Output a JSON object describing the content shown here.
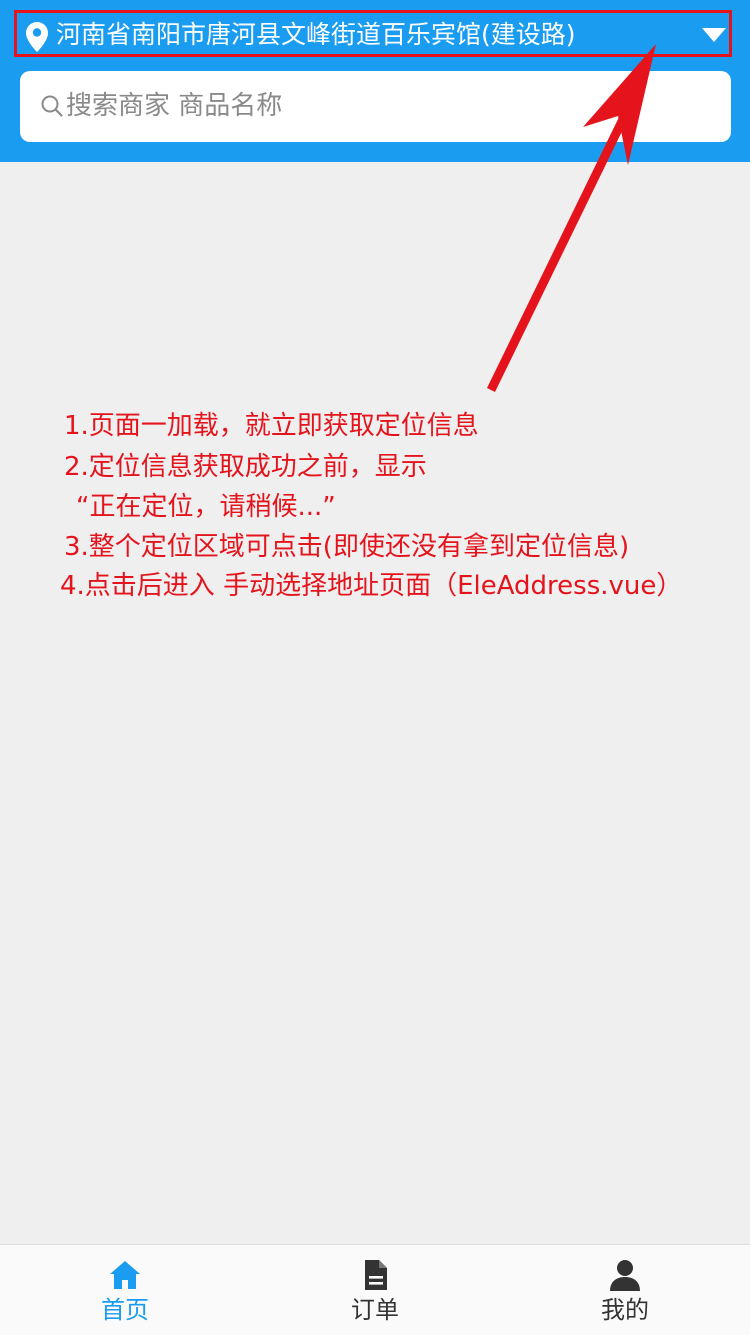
{
  "header": {
    "location_text": "河南省南阳市唐河县文峰街道百乐宾馆(建设路)",
    "search_placeholder": "搜索商家 商品名称"
  },
  "annotations": [
    "1.页面一加载，就立即获取定位信息",
    "2.定位信息获取成功之前，显示",
    "“正在定位，请稍候...”",
    "3.整个定位区域可点击(即使还没有拿到定位信息)",
    "4.点击后进入 手动选择地址页面（EleAddress.vue）"
  ],
  "tabbar": {
    "tabs": [
      {
        "label": "首页",
        "icon": "home-icon",
        "active": true
      },
      {
        "label": "订单",
        "icon": "order-icon",
        "active": false
      },
      {
        "label": "我的",
        "icon": "user-icon",
        "active": false
      }
    ]
  },
  "colors": {
    "primary": "#1a9cf0",
    "annotation": "#e5141c",
    "background": "#efefef",
    "tab_inactive": "#333333"
  }
}
